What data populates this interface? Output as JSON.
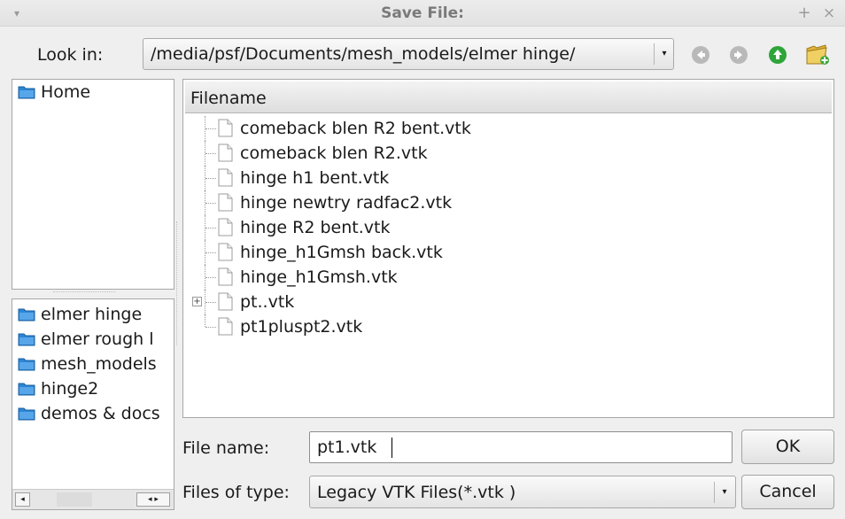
{
  "window": {
    "title": "Save File:",
    "menu_glyph": "▾",
    "plus_glyph": "+",
    "close_glyph": "×"
  },
  "lookin": {
    "label": "Look in:",
    "path": "/media/psf/Documents/mesh_models/elmer hinge/",
    "arrow": "▾"
  },
  "nav_icons": [
    "back-icon",
    "forward-icon",
    "up-icon",
    "new-folder-icon"
  ],
  "sidebar": {
    "places": [
      {
        "label": "Home"
      }
    ],
    "recent": [
      {
        "label": "elmer hinge"
      },
      {
        "label": "elmer rough l"
      },
      {
        "label": "mesh_models"
      },
      {
        "label": "hinge2"
      },
      {
        "label": "demos & docs"
      }
    ],
    "scroll_left": "◂",
    "scroll_right": "◂ ▸"
  },
  "filelist": {
    "header": "Filename",
    "files": [
      {
        "name": "comeback blen R2 bent.vtk"
      },
      {
        "name": "comeback blen R2.vtk"
      },
      {
        "name": "hinge h1 bent.vtk"
      },
      {
        "name": "hinge newtry radfac2.vtk"
      },
      {
        "name": "hinge R2 bent.vtk"
      },
      {
        "name": "hinge_h1Gmsh back.vtk"
      },
      {
        "name": "hinge_h1Gmsh.vtk"
      },
      {
        "name": "pt..vtk",
        "expander": "+"
      },
      {
        "name": "pt1pluspt2.vtk"
      }
    ]
  },
  "form": {
    "filename_label": "File name:",
    "filename_value": "pt1.vtk",
    "filetype_label": "Files of type:",
    "filetype_value": "Legacy VTK Files(*.vtk )",
    "filetype_arrow": "▾",
    "ok_label": "OK",
    "cancel_label": "Cancel"
  },
  "colors": {
    "folder": "#2b86d6",
    "nav_grey": "#b9b9b9",
    "nav_up": "#2ea43a",
    "new_folder": "#e0b43a"
  }
}
